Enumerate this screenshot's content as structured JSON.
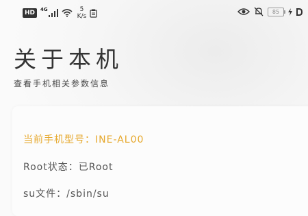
{
  "status_bar": {
    "hd": "HD",
    "network_type": "4G",
    "speed_value": "5",
    "speed_unit": "K/s",
    "battery": "85",
    "icons": [
      "signal-icon",
      "wifi-icon",
      "clipboard-icon",
      "eye-icon",
      "bell-muted-icon",
      "battery-icon",
      "charging-icon",
      "mobile-data-icon"
    ]
  },
  "page": {
    "title": "关于本机",
    "subtitle": "查看手机相关参数信息"
  },
  "info": {
    "model": "当前手机型号：INE-AL00",
    "root": "Root状态：已Root",
    "su": "su文件：/sbin/su"
  },
  "colors": {
    "accent": "#e6a82c",
    "text": "#555555"
  }
}
